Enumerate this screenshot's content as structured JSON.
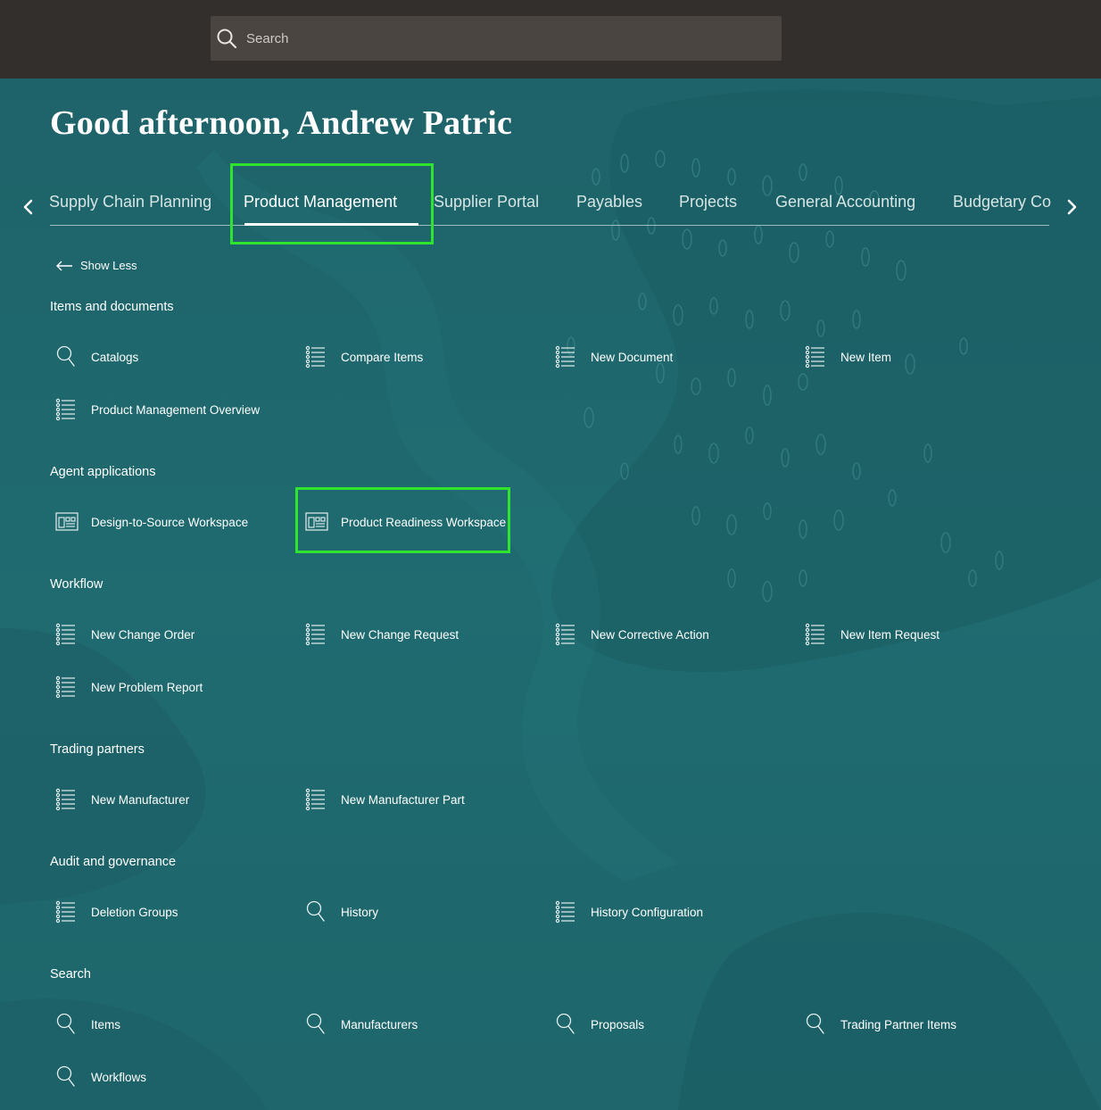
{
  "search": {
    "placeholder": "Search"
  },
  "greeting": "Good afternoon, Andrew Patric",
  "tabs": [
    {
      "label": "Supply Chain Planning"
    },
    {
      "label": "Product Management",
      "active": true
    },
    {
      "label": "Supplier Portal"
    },
    {
      "label": "Payables"
    },
    {
      "label": "Projects"
    },
    {
      "label": "General Accounting"
    },
    {
      "label": "Budgetary Control"
    }
  ],
  "show_less": "Show Less",
  "sections": {
    "items_docs": {
      "title": "Items and documents",
      "items": [
        {
          "label": "Catalogs",
          "icon": "search-icon"
        },
        {
          "label": "Compare Items",
          "icon": "list-icon"
        },
        {
          "label": "New Document",
          "icon": "list-icon"
        },
        {
          "label": "New Item",
          "icon": "list-icon"
        },
        {
          "label": "Product Management Overview",
          "icon": "list-icon"
        }
      ]
    },
    "agent_apps": {
      "title": "Agent applications",
      "items": [
        {
          "label": "Design-to-Source Workspace",
          "icon": "workspace-icon"
        },
        {
          "label": "Product Readiness Workspace",
          "icon": "workspace-icon"
        }
      ]
    },
    "workflow": {
      "title": "Workflow",
      "items": [
        {
          "label": "New Change Order",
          "icon": "list-icon"
        },
        {
          "label": "New Change Request",
          "icon": "list-icon"
        },
        {
          "label": "New Corrective Action",
          "icon": "list-icon"
        },
        {
          "label": "New Item Request",
          "icon": "list-icon"
        },
        {
          "label": "New Problem Report",
          "icon": "list-icon"
        }
      ]
    },
    "trading": {
      "title": "Trading partners",
      "items": [
        {
          "label": "New Manufacturer",
          "icon": "list-icon"
        },
        {
          "label": "New Manufacturer Part",
          "icon": "list-icon"
        }
      ]
    },
    "audit": {
      "title": "Audit and governance",
      "items": [
        {
          "label": "Deletion Groups",
          "icon": "list-icon"
        },
        {
          "label": "History",
          "icon": "search-icon"
        },
        {
          "label": "History Configuration",
          "icon": "list-icon"
        }
      ]
    },
    "search": {
      "title": "Search",
      "items": [
        {
          "label": "Items",
          "icon": "search-icon"
        },
        {
          "label": "Manufacturers",
          "icon": "search-icon"
        },
        {
          "label": "Proposals",
          "icon": "search-icon"
        },
        {
          "label": "Trading Partner Items",
          "icon": "search-icon"
        },
        {
          "label": "Workflows",
          "icon": "search-icon"
        }
      ]
    }
  },
  "colors": {
    "topbar": "#332f2c",
    "background": "#1f6a6f",
    "highlight": "#2fe42f"
  }
}
